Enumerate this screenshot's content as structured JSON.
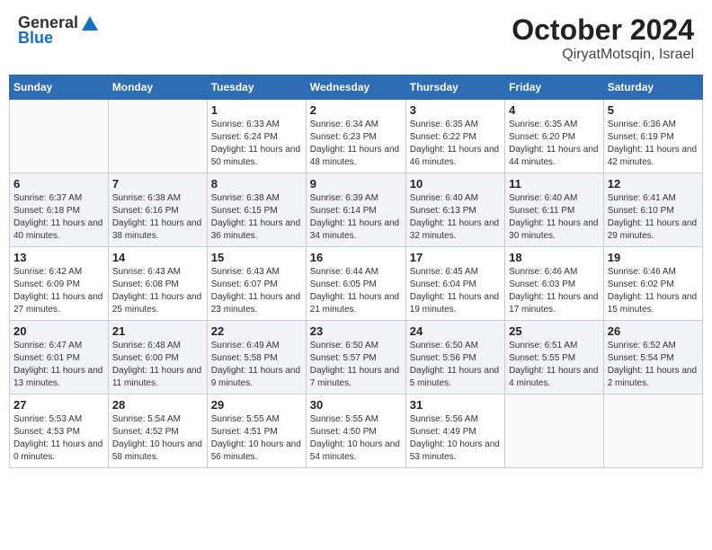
{
  "header": {
    "logo_general": "General",
    "logo_blue": "Blue",
    "month_title": "October 2024",
    "location": "QiryatMotsqin, Israel"
  },
  "weekdays": [
    "Sunday",
    "Monday",
    "Tuesday",
    "Wednesday",
    "Thursday",
    "Friday",
    "Saturday"
  ],
  "weeks": [
    [
      {
        "day": "",
        "sunrise": "",
        "sunset": "",
        "daylight": ""
      },
      {
        "day": "",
        "sunrise": "",
        "sunset": "",
        "daylight": ""
      },
      {
        "day": "1",
        "sunrise": "Sunrise: 6:33 AM",
        "sunset": "Sunset: 6:24 PM",
        "daylight": "Daylight: 11 hours and 50 minutes."
      },
      {
        "day": "2",
        "sunrise": "Sunrise: 6:34 AM",
        "sunset": "Sunset: 6:23 PM",
        "daylight": "Daylight: 11 hours and 48 minutes."
      },
      {
        "day": "3",
        "sunrise": "Sunrise: 6:35 AM",
        "sunset": "Sunset: 6:22 PM",
        "daylight": "Daylight: 11 hours and 46 minutes."
      },
      {
        "day": "4",
        "sunrise": "Sunrise: 6:35 AM",
        "sunset": "Sunset: 6:20 PM",
        "daylight": "Daylight: 11 hours and 44 minutes."
      },
      {
        "day": "5",
        "sunrise": "Sunrise: 6:36 AM",
        "sunset": "Sunset: 6:19 PM",
        "daylight": "Daylight: 11 hours and 42 minutes."
      }
    ],
    [
      {
        "day": "6",
        "sunrise": "Sunrise: 6:37 AM",
        "sunset": "Sunset: 6:18 PM",
        "daylight": "Daylight: 11 hours and 40 minutes."
      },
      {
        "day": "7",
        "sunrise": "Sunrise: 6:38 AM",
        "sunset": "Sunset: 6:16 PM",
        "daylight": "Daylight: 11 hours and 38 minutes."
      },
      {
        "day": "8",
        "sunrise": "Sunrise: 6:38 AM",
        "sunset": "Sunset: 6:15 PM",
        "daylight": "Daylight: 11 hours and 36 minutes."
      },
      {
        "day": "9",
        "sunrise": "Sunrise: 6:39 AM",
        "sunset": "Sunset: 6:14 PM",
        "daylight": "Daylight: 11 hours and 34 minutes."
      },
      {
        "day": "10",
        "sunrise": "Sunrise: 6:40 AM",
        "sunset": "Sunset: 6:13 PM",
        "daylight": "Daylight: 11 hours and 32 minutes."
      },
      {
        "day": "11",
        "sunrise": "Sunrise: 6:40 AM",
        "sunset": "Sunset: 6:11 PM",
        "daylight": "Daylight: 11 hours and 30 minutes."
      },
      {
        "day": "12",
        "sunrise": "Sunrise: 6:41 AM",
        "sunset": "Sunset: 6:10 PM",
        "daylight": "Daylight: 11 hours and 29 minutes."
      }
    ],
    [
      {
        "day": "13",
        "sunrise": "Sunrise: 6:42 AM",
        "sunset": "Sunset: 6:09 PM",
        "daylight": "Daylight: 11 hours and 27 minutes."
      },
      {
        "day": "14",
        "sunrise": "Sunrise: 6:43 AM",
        "sunset": "Sunset: 6:08 PM",
        "daylight": "Daylight: 11 hours and 25 minutes."
      },
      {
        "day": "15",
        "sunrise": "Sunrise: 6:43 AM",
        "sunset": "Sunset: 6:07 PM",
        "daylight": "Daylight: 11 hours and 23 minutes."
      },
      {
        "day": "16",
        "sunrise": "Sunrise: 6:44 AM",
        "sunset": "Sunset: 6:05 PM",
        "daylight": "Daylight: 11 hours and 21 minutes."
      },
      {
        "day": "17",
        "sunrise": "Sunrise: 6:45 AM",
        "sunset": "Sunset: 6:04 PM",
        "daylight": "Daylight: 11 hours and 19 minutes."
      },
      {
        "day": "18",
        "sunrise": "Sunrise: 6:46 AM",
        "sunset": "Sunset: 6:03 PM",
        "daylight": "Daylight: 11 hours and 17 minutes."
      },
      {
        "day": "19",
        "sunrise": "Sunrise: 6:46 AM",
        "sunset": "Sunset: 6:02 PM",
        "daylight": "Daylight: 11 hours and 15 minutes."
      }
    ],
    [
      {
        "day": "20",
        "sunrise": "Sunrise: 6:47 AM",
        "sunset": "Sunset: 6:01 PM",
        "daylight": "Daylight: 11 hours and 13 minutes."
      },
      {
        "day": "21",
        "sunrise": "Sunrise: 6:48 AM",
        "sunset": "Sunset: 6:00 PM",
        "daylight": "Daylight: 11 hours and 11 minutes."
      },
      {
        "day": "22",
        "sunrise": "Sunrise: 6:49 AM",
        "sunset": "Sunset: 5:58 PM",
        "daylight": "Daylight: 11 hours and 9 minutes."
      },
      {
        "day": "23",
        "sunrise": "Sunrise: 6:50 AM",
        "sunset": "Sunset: 5:57 PM",
        "daylight": "Daylight: 11 hours and 7 minutes."
      },
      {
        "day": "24",
        "sunrise": "Sunrise: 6:50 AM",
        "sunset": "Sunset: 5:56 PM",
        "daylight": "Daylight: 11 hours and 5 minutes."
      },
      {
        "day": "25",
        "sunrise": "Sunrise: 6:51 AM",
        "sunset": "Sunset: 5:55 PM",
        "daylight": "Daylight: 11 hours and 4 minutes."
      },
      {
        "day": "26",
        "sunrise": "Sunrise: 6:52 AM",
        "sunset": "Sunset: 5:54 PM",
        "daylight": "Daylight: 11 hours and 2 minutes."
      }
    ],
    [
      {
        "day": "27",
        "sunrise": "Sunrise: 5:53 AM",
        "sunset": "Sunset: 4:53 PM",
        "daylight": "Daylight: 11 hours and 0 minutes."
      },
      {
        "day": "28",
        "sunrise": "Sunrise: 5:54 AM",
        "sunset": "Sunset: 4:52 PM",
        "daylight": "Daylight: 10 hours and 58 minutes."
      },
      {
        "day": "29",
        "sunrise": "Sunrise: 5:55 AM",
        "sunset": "Sunset: 4:51 PM",
        "daylight": "Daylight: 10 hours and 56 minutes."
      },
      {
        "day": "30",
        "sunrise": "Sunrise: 5:55 AM",
        "sunset": "Sunset: 4:50 PM",
        "daylight": "Daylight: 10 hours and 54 minutes."
      },
      {
        "day": "31",
        "sunrise": "Sunrise: 5:56 AM",
        "sunset": "Sunset: 4:49 PM",
        "daylight": "Daylight: 10 hours and 53 minutes."
      },
      {
        "day": "",
        "sunrise": "",
        "sunset": "",
        "daylight": ""
      },
      {
        "day": "",
        "sunrise": "",
        "sunset": "",
        "daylight": ""
      }
    ]
  ]
}
